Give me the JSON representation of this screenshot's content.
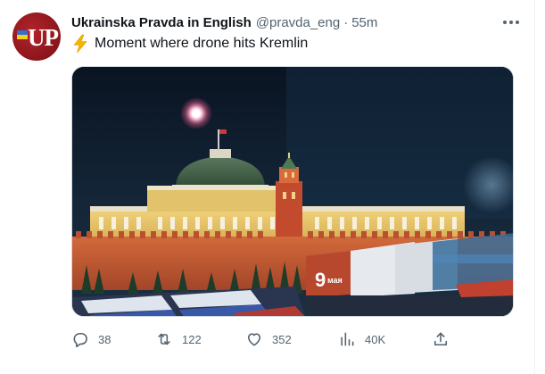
{
  "tweet": {
    "author_name": "Ukrainska Pravda in English",
    "handle": "@pravda_eng",
    "separator": "·",
    "time": "55m",
    "text": "Moment where drone hits Kremlin",
    "avatar_text": "UP",
    "media_alt": "Kremlin Senate building at night with an explosion above the dome",
    "media_banner_number": "9",
    "media_banner_word": "мая"
  },
  "actions": {
    "replies": "38",
    "retweets": "122",
    "likes": "352",
    "views": "40K"
  },
  "icons": {
    "verified": "none",
    "zap": "high-voltage-emoji-icon",
    "reply": "reply-icon",
    "retweet": "retweet-icon",
    "like": "heart-icon",
    "views": "analytics-icon",
    "share": "share-icon",
    "more": "more-icon"
  },
  "colors": {
    "text_primary": "#0f1419",
    "text_secondary": "#536471",
    "avatar": "#8b151c",
    "border": "#cfd9de"
  }
}
